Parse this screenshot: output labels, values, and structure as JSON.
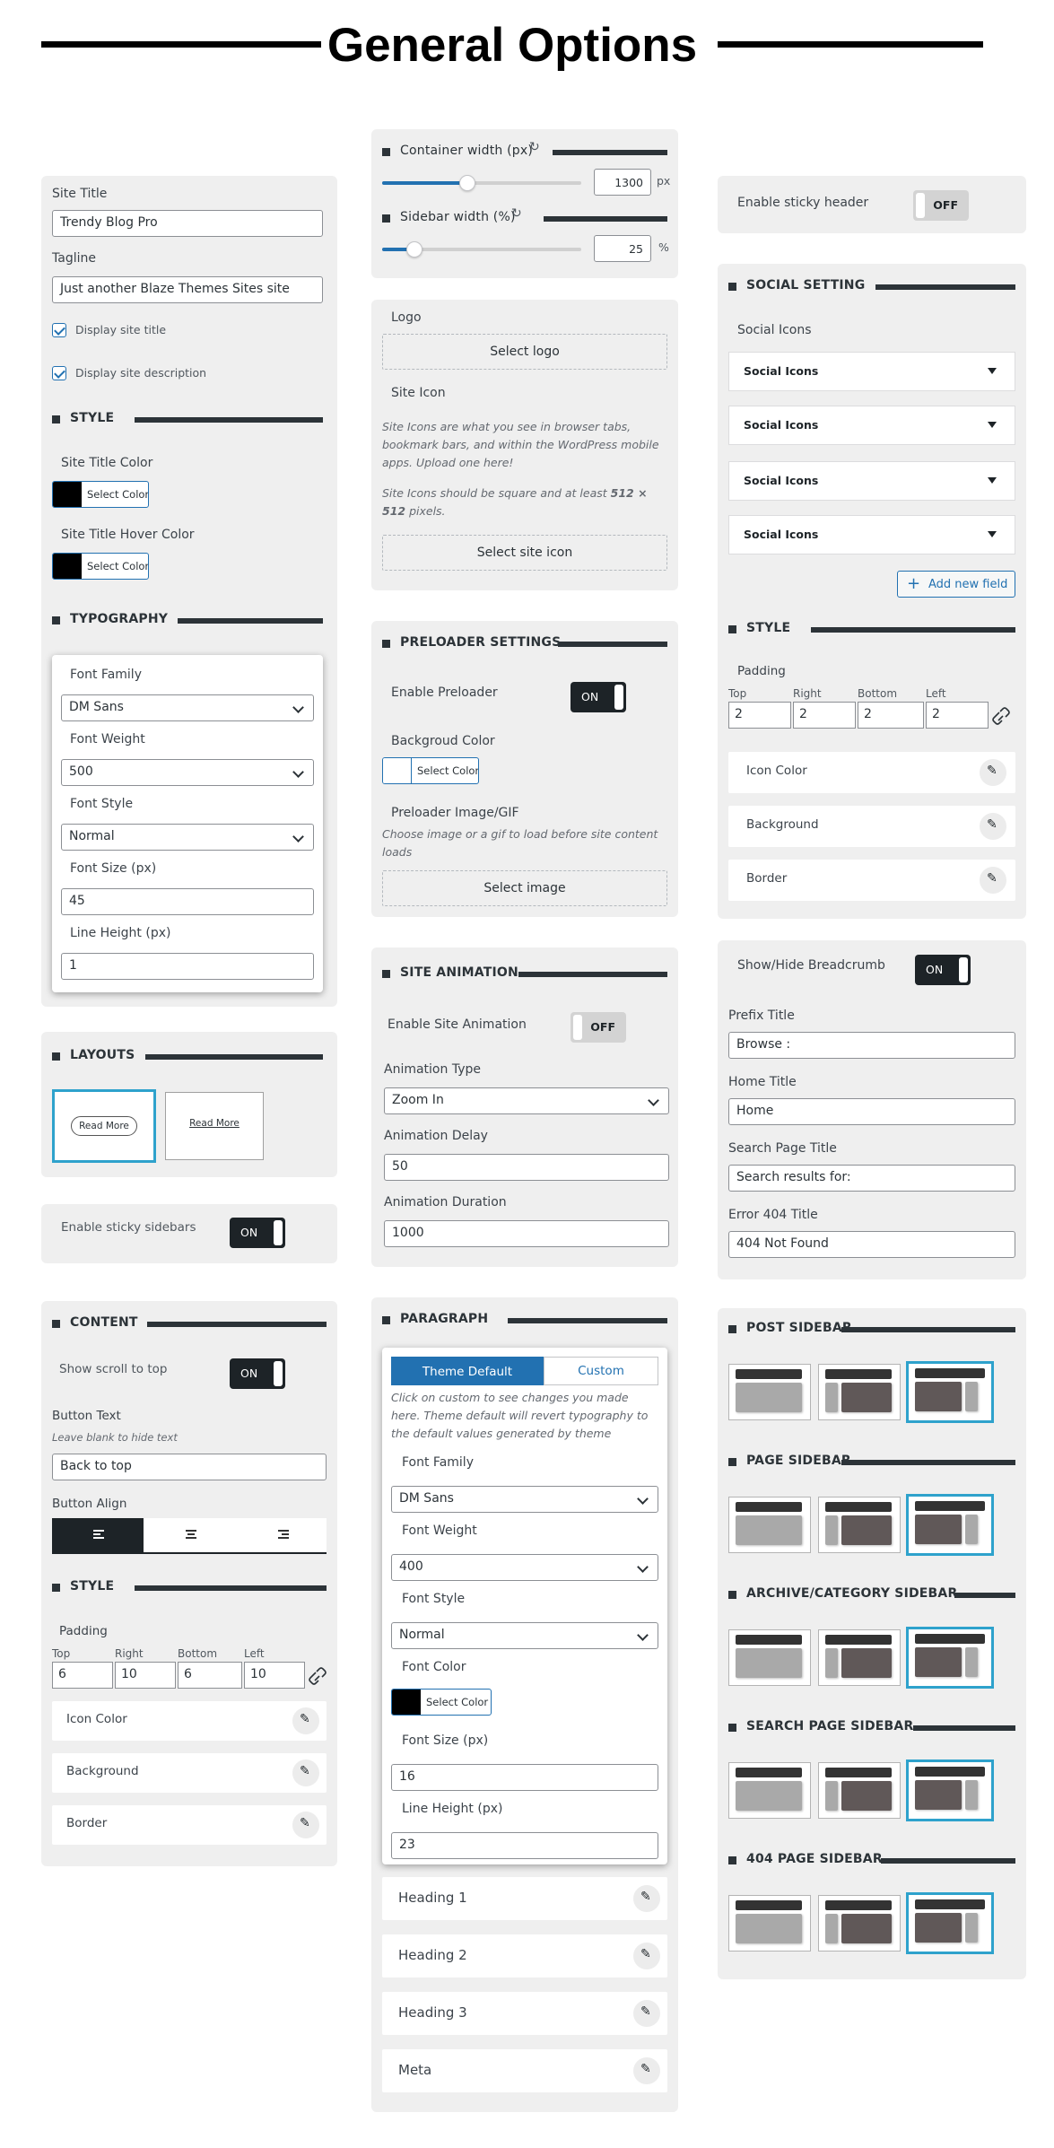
{
  "page": {
    "title": "General Options"
  },
  "site": {
    "site_title_label": "Site Title",
    "site_title_value": "Trendy Blog Pro",
    "tagline_label": "Tagline",
    "tagline_value": "Just another Blaze Themes Sites site",
    "display_title_label": "Display site title",
    "display_desc_label": "Display site description",
    "style_heading": "STYLE",
    "title_color_label": "Site Title Color",
    "title_hover_color_label": "Site Title Hover Color",
    "select_color": "Select Color",
    "typography_heading": "TYPOGRAPHY"
  },
  "typo": {
    "family_label": "Font Family",
    "family_value": "DM Sans",
    "weight_label": "Font Weight",
    "weight_value": "500",
    "style_label": "Font Style",
    "style_value": "Normal",
    "size_label": "Font Size (px)",
    "size_value": "45",
    "lh_label": "Line Height (px)",
    "lh_value": "1"
  },
  "layouts": {
    "heading": "LAYOUTS",
    "opt1": "Read More",
    "opt2": "Read More"
  },
  "sticky_sidebars": {
    "label": "Enable sticky sidebars",
    "state": "ON"
  },
  "content": {
    "heading": "CONTENT",
    "scroll_label": "Show scroll to top",
    "scroll_state": "ON",
    "btn_text_label": "Button Text",
    "btn_text_desc": "Leave blank to hide text",
    "btn_text_value": "Back to top",
    "btn_align_label": "Button Align",
    "style_heading": "STYLE",
    "padding_label": "Padding",
    "top": "Top",
    "right": "Right",
    "bottom": "Bottom",
    "left": "Left",
    "pad_top": "6",
    "pad_right": "10",
    "pad_bottom": "6",
    "pad_left": "10",
    "icon_color": "Icon Color",
    "background": "Background",
    "border": "Border"
  },
  "container": {
    "label": "Container width (px)",
    "value": "1300",
    "unit": "px",
    "fraction": 0.43
  },
  "sidebar_width": {
    "label": "Sidebar width (%)",
    "value": "25",
    "unit": "%",
    "fraction": 0.16
  },
  "logo": {
    "label": "Logo",
    "button": "Select logo",
    "icon_label": "Site Icon",
    "desc1": "Site Icons are what you see in browser tabs, bookmark bars, and within the WordPress mobile apps. Upload one here!",
    "desc2_a": "Site Icons should be square and at least ",
    "desc2_b": "512 × 512",
    "desc2_c": " pixels.",
    "icon_button": "Select site icon"
  },
  "preloader": {
    "heading": "PRELOADER SETTINGS",
    "enable_label": "Enable Preloader",
    "state": "ON",
    "bg_label": "Backgroud Color",
    "select_color": "Select Color",
    "image_label": "Preloader Image/GIF",
    "image_desc": "Choose image or a gif to load before site content loads",
    "image_button": "Select image"
  },
  "animation": {
    "heading": "SITE ANIMATION",
    "enable_label": "Enable Site Animation",
    "state": "OFF",
    "type_label": "Animation Type",
    "type_value": "Zoom In",
    "delay_label": "Animation Delay",
    "delay_value": "50",
    "duration_label": "Animation Duration",
    "duration_value": "1000"
  },
  "paragraph": {
    "heading": "PARAGRAPH",
    "tab_default": "Theme Default",
    "tab_custom": "Custom",
    "desc": "Click on custom to see changes you made here. Theme default will revert typography to the default values generated by theme",
    "family_label": "Font Family",
    "family_value": "DM Sans",
    "weight_label": "Font Weight",
    "weight_value": "400",
    "style_label": "Font Style",
    "style_value": "Normal",
    "color_label": "Font Color",
    "select_color": "Select Color",
    "size_label": "Font Size (px)",
    "size_value": "16",
    "lh_label": "Line Height (px)",
    "lh_value": "23",
    "items": [
      "Heading 1",
      "Heading 2",
      "Heading 3",
      "Meta"
    ]
  },
  "sticky_header": {
    "label": "Enable sticky header",
    "state": "OFF"
  },
  "social": {
    "heading": "SOCIAL SETTING",
    "icons_label": "Social Icons",
    "items": [
      "Social Icons",
      "Social Icons",
      "Social Icons",
      "Social Icons"
    ],
    "add_label": "Add new field",
    "style_heading": "STYLE",
    "padding_label": "Padding",
    "top": "Top",
    "right": "Right",
    "bottom": "Bottom",
    "left": "Left",
    "pad_top": "2",
    "pad_right": "2",
    "pad_bottom": "2",
    "pad_left": "2",
    "icon_color": "Icon Color",
    "background": "Background",
    "border": "Border"
  },
  "breadcrumb": {
    "label": "Show/Hide Breadcrumb",
    "state": "ON",
    "prefix_label": "Prefix Title",
    "prefix_value": "Browse :",
    "home_label": "Home Title",
    "home_value": "Home",
    "search_label": "Search Page Title",
    "search_value": "Search results for:",
    "e404_label": "Error 404 Title",
    "e404_value": "404 Not Found"
  },
  "sidebars": {
    "post": "POST SIDEBAR",
    "page": "PAGE SIDEBAR",
    "archive": "ARCHIVE/CATEGORY SIDEBAR",
    "search": "SEARCH PAGE SIDEBAR",
    "e404": "404 PAGE SIDEBAR"
  },
  "colors": {
    "accent": "#2271b1",
    "selected_border": "#2ea2cc",
    "dark": "#1d2327",
    "panel": "#efefef"
  }
}
